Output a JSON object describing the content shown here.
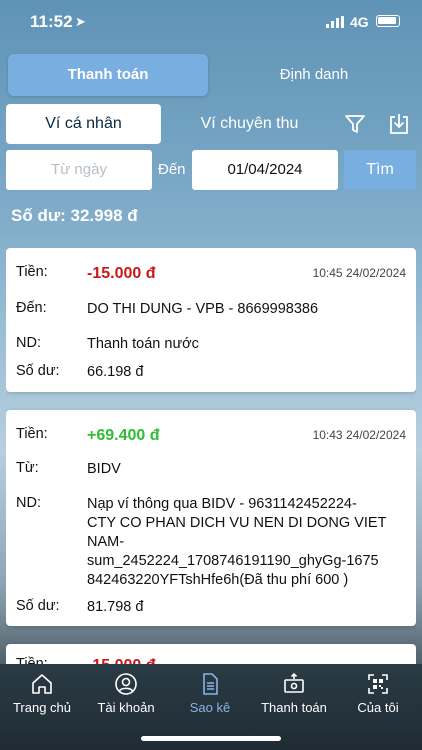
{
  "status_bar": {
    "time": "11:52",
    "network": "4G"
  },
  "top_tabs": [
    {
      "label": "Thanh toán",
      "active": true
    },
    {
      "label": "Định danh",
      "active": false
    }
  ],
  "wallet_tabs": [
    {
      "label": "Ví cá nhân",
      "active": true
    },
    {
      "label": "Ví chuyên thu",
      "active": false
    }
  ],
  "filter": {
    "from_placeholder": "Từ ngày",
    "to_label": "Đến",
    "to_value": "01/04/2024",
    "search_label": "Tìm"
  },
  "balance_text": "Số dư: 32.998 đ",
  "transactions": [
    {
      "amount_label": "Tiền:",
      "amount": "-15.000 đ",
      "time": "10:45 24/02/2024",
      "party_label": "Đến:",
      "party": "DO THI DUNG - VPB - 8669998386",
      "note_label": "ND:",
      "note": "Thanh toán nước",
      "balance_label": "Số dư:",
      "balance": "66.198 đ"
    },
    {
      "amount_label": "Tiền:",
      "amount": "+69.400 đ",
      "time": "10:43 24/02/2024",
      "party_label": "Từ:",
      "party": "BIDV",
      "note_label": "ND:",
      "note_lines": [
        "Nạp ví thông qua BIDV - 9631142452224-",
        "CTY CO PHAN DICH VU NEN DI DONG VIET",
        "NAM-",
        "sum_2452224_1708746191190_ghyGg-1675",
        "842463220YFTshHfe6h(Đã thu phí 600 )"
      ],
      "balance_label": "Số dư:",
      "balance": "81.798 đ"
    },
    {
      "amount_label": "Tiền:",
      "amount": "-15.000 đ"
    }
  ],
  "tab_bar": [
    {
      "label": "Trang chủ",
      "icon": "home-icon",
      "active": false
    },
    {
      "label": "Tài khoản",
      "icon": "user-icon",
      "active": false
    },
    {
      "label": "Sao kê",
      "icon": "document-icon",
      "active": true
    },
    {
      "label": "Thanh toán",
      "icon": "payment-icon",
      "active": false
    },
    {
      "label": "Của tôi",
      "icon": "qr-icon",
      "active": false
    }
  ],
  "colors": {
    "accent": "#79aee0",
    "negative": "#c81818",
    "positive": "#2ebd33",
    "active_tab": "#8ab4e4"
  }
}
